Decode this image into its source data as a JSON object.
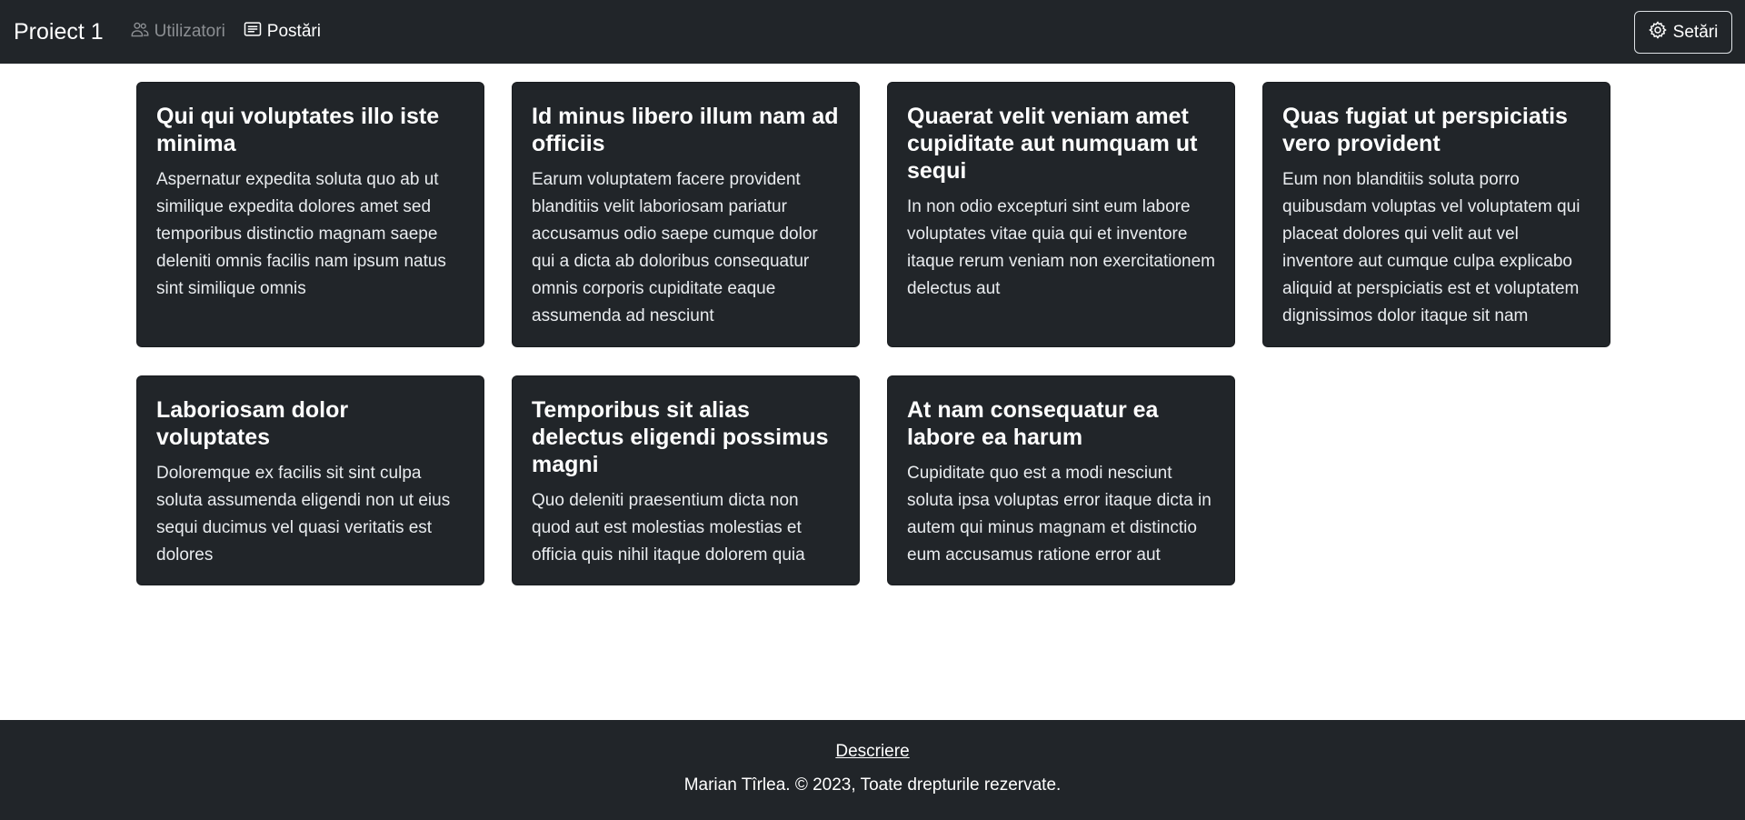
{
  "navbar": {
    "brand": "Proiect 1",
    "links": [
      {
        "label": "Utilizatori",
        "icon": "users-icon",
        "active": false
      },
      {
        "label": "Postări",
        "icon": "posts-icon",
        "active": true
      }
    ],
    "settings_label": "Setări",
    "settings_icon": "gear-icon"
  },
  "posts": [
    {
      "title": "Qui qui voluptates illo iste minima",
      "body": "Aspernatur expedita soluta quo ab ut similique expedita dolores amet sed temporibus distinctio magnam saepe deleniti omnis facilis nam ipsum natus sint similique omnis"
    },
    {
      "title": "Id minus libero illum nam ad officiis",
      "body": "Earum voluptatem facere provident blanditiis velit laboriosam pariatur accusamus odio saepe cumque dolor qui a dicta ab doloribus consequatur omnis corporis cupiditate eaque assumenda ad nesciunt"
    },
    {
      "title": "Quaerat velit veniam amet cupiditate aut numquam ut sequi",
      "body": "In non odio excepturi sint eum labore voluptates vitae quia qui et inventore itaque rerum veniam non exercitationem delectus aut"
    },
    {
      "title": "Quas fugiat ut perspiciatis vero provident",
      "body": "Eum non blanditiis soluta porro quibusdam voluptas vel voluptatem qui placeat dolores qui velit aut vel inventore aut cumque culpa explicabo aliquid at perspiciatis est et voluptatem dignissimos dolor itaque sit nam"
    },
    {
      "title": "Laboriosam dolor voluptates",
      "body": "Doloremque ex facilis sit sint culpa soluta assumenda eligendi non ut eius sequi ducimus vel quasi veritatis est dolores"
    },
    {
      "title": "Temporibus sit alias delectus eligendi possimus magni",
      "body": "Quo deleniti praesentium dicta non quod aut est molestias molestias et officia quis nihil itaque dolorem quia"
    },
    {
      "title": "At nam consequatur ea labore ea harum",
      "body": "Cupiditate quo est a modi nesciunt soluta ipsa voluptas error itaque dicta in autem qui minus magnam et distinctio eum accusamus ratione error aut"
    }
  ],
  "footer": {
    "link_label": "Descriere",
    "copyright": "Marian Tîrlea. © 2023, Toate drepturile rezervate."
  },
  "colors": {
    "dark_bg": "#212529",
    "muted_link": "#8c8f93",
    "text_light": "#ffffff"
  }
}
